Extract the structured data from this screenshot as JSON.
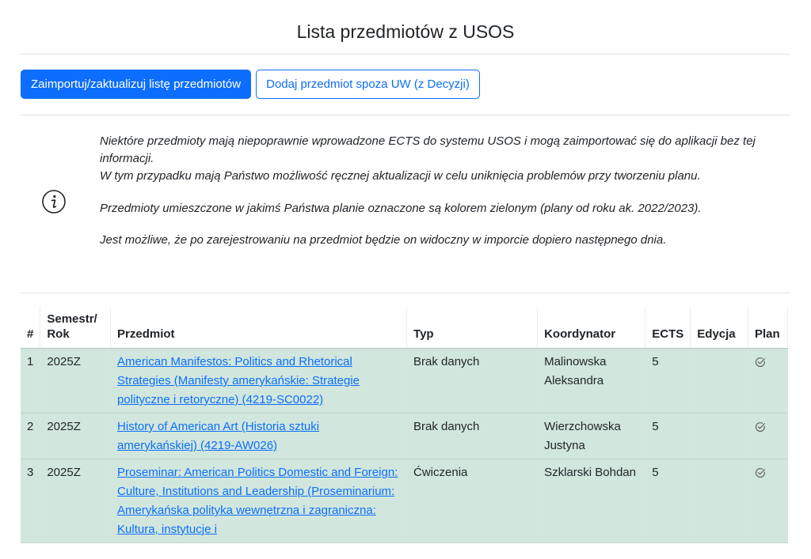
{
  "page": {
    "title": "Lista przedmiotów z USOS"
  },
  "toolbar": {
    "import_label": "Zaimportuj/zaktualizuj listę przedmiotów",
    "add_label": "Dodaj przedmiot spoza UW (z Decyzji)"
  },
  "info": {
    "icon": "info-icon",
    "line1": "Niektóre przedmioty mają niepoprawnie wprowadzone ECTS do systemu USOS i mogą zaimportować się do aplikacji bez tej informacji.",
    "line2": "W tym przypadku mają Państwo możliwość ręcznej aktualizacji w celu uniknięcia problemów przy tworzeniu planu.",
    "line3": "Przedmioty umieszczone w jakimś Państwa planie oznaczone są kolorem zielonym (plany od roku ak. 2022/2023).",
    "line4": "Jest możliwe, że po zarejestrowaniu na przedmiot będzie on widoczny w imporcie dopiero następnego dnia."
  },
  "table": {
    "headers": {
      "num": "#",
      "semester_line1": "Semestr/",
      "semester_line2": "Rok",
      "course": "Przedmiot",
      "type": "Typ",
      "coordinator": "Koordynator",
      "ects": "ECTS",
      "edition": "Edycja",
      "plan": "Plan"
    },
    "rows": [
      {
        "num": "1",
        "semester": "2025Z",
        "course": "American Manifestos: Politics and Rhetorical Strategies (Manifesty amerykańskie: Strategie polityczne i retoryczne) (4219-SC0022)",
        "type": "Brak danych",
        "coordinator": "Malinowska Aleksandra",
        "ects": "5",
        "edition": "",
        "plan_icon": "check-circle-icon"
      },
      {
        "num": "2",
        "semester": "2025Z",
        "course": "History of American Art (Historia sztuki amerykańskiej) (4219-AW026)",
        "type": "Brak danych",
        "coordinator": "Wierzchowska Justyna",
        "ects": "5",
        "edition": "",
        "plan_icon": "check-circle-icon"
      },
      {
        "num": "3",
        "semester": "2025Z",
        "course": "Proseminar: American Politics Domestic and Foreign: Culture, Institutions and Leadership (Proseminarium: Amerykańska polityka wewnętrzna i zagraniczna: Kultura, instytucje i",
        "type": "Ćwiczenia",
        "coordinator": "Szklarski Bohdan",
        "ects": "5",
        "edition": "",
        "plan_icon": "check-circle-icon"
      }
    ]
  },
  "colors": {
    "accent": "#0d6efd",
    "planned_row": "#d1e7dd"
  }
}
